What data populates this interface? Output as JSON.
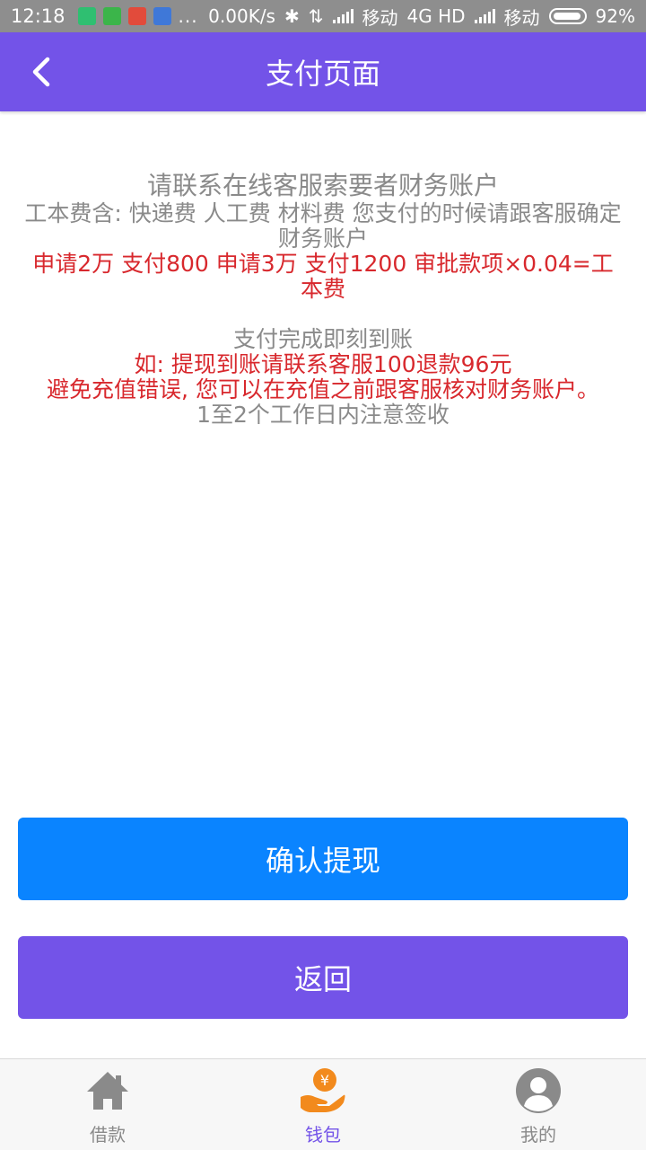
{
  "status_bar": {
    "time": "12:18",
    "dots": "...",
    "net_speed": "0.00K/s",
    "carrier1": "移动",
    "network": "4G HD",
    "carrier2": "移动",
    "battery": "92%"
  },
  "header": {
    "title": "支付页面",
    "back_icon": "chevron-left-icon"
  },
  "notice": {
    "line1": "请联系在线客服索要者财务账户",
    "line2": "工本费含: 快递费 人工费 材料费 您支付的时候请跟客服确定财务账户",
    "line3": "申请2万 支付800  申请3万 支付1200 审批款项×0.04=工本费",
    "line4": "支付完成即刻到账",
    "line5": "如: 提现到账请联系客服100退款96元",
    "line6": "避免充值错误, 您可以在充值之前跟客服核对财务账户。",
    "line7": "1至2个工作日内注意签收"
  },
  "buttons": {
    "confirm_label": "确认提现",
    "back_label": "返回"
  },
  "tabbar": {
    "items": [
      {
        "label": "借款",
        "icon": "home-icon",
        "active": false
      },
      {
        "label": "钱包",
        "icon": "wallet-icon",
        "active": true
      },
      {
        "label": "我的",
        "icon": "user-icon",
        "active": false
      }
    ]
  },
  "colors": {
    "primary": "#7353e8",
    "confirm": "#0a84ff",
    "warning_text": "#d8282d",
    "muted_text": "#8a8a8a",
    "wallet_orange": "#f28a1d"
  }
}
